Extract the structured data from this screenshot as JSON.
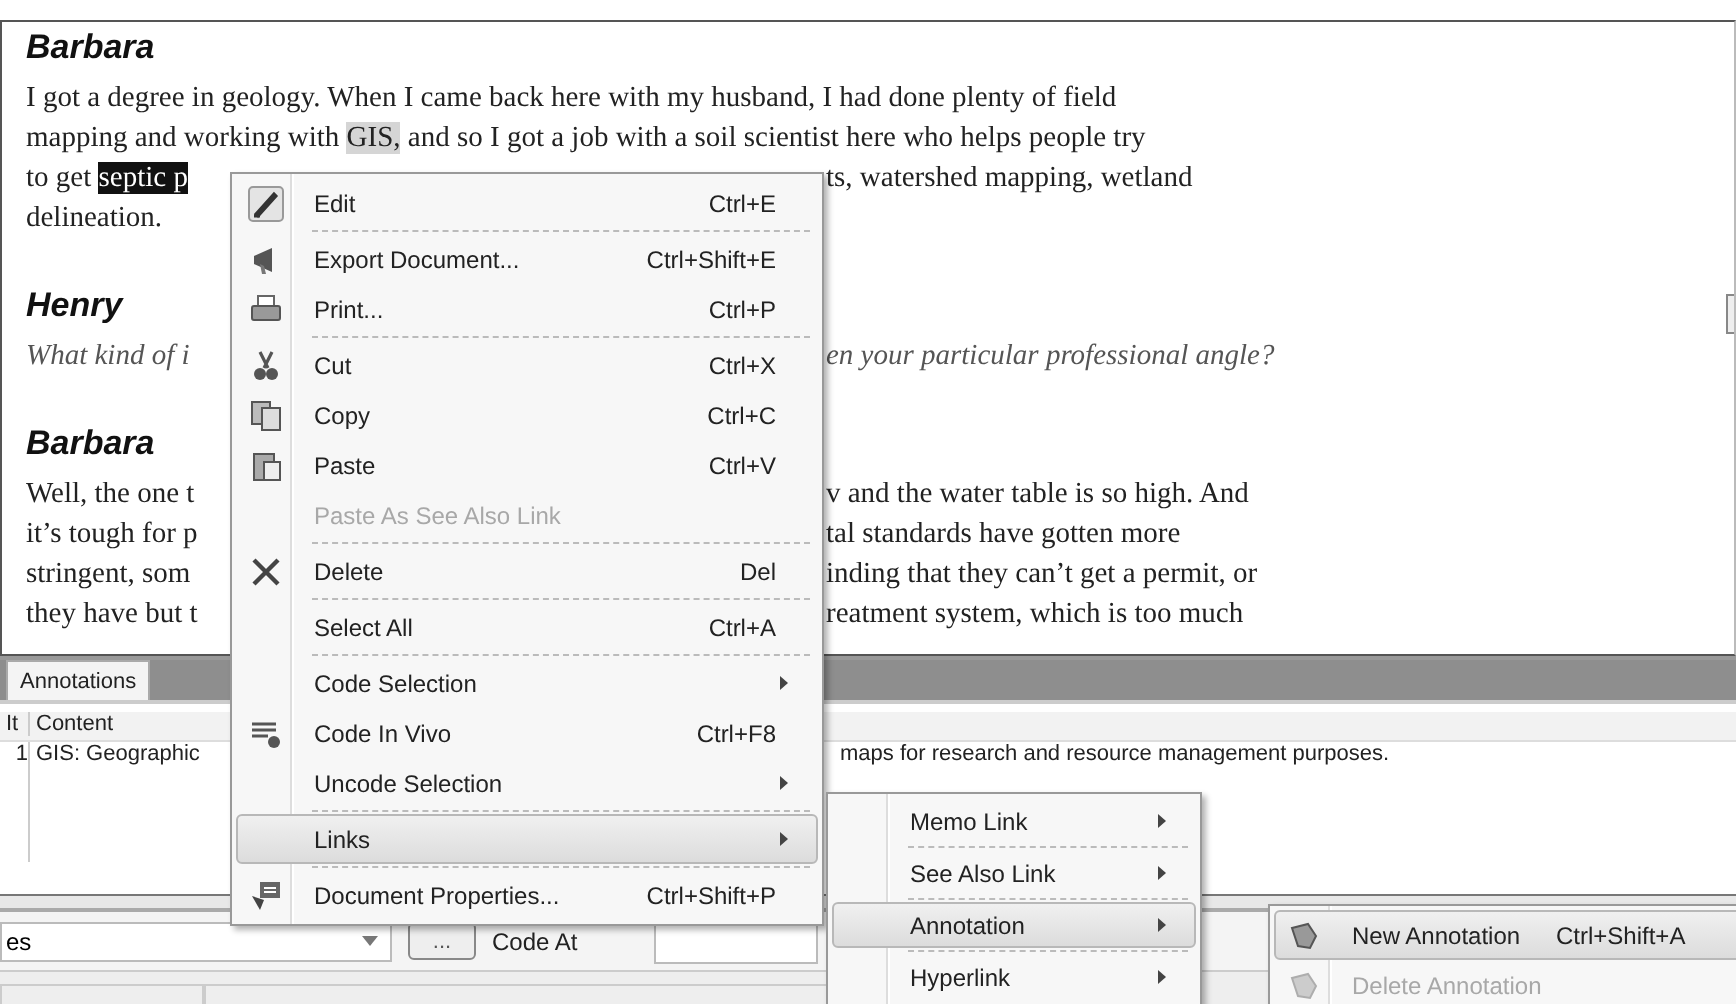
{
  "document": {
    "blocks": [
      {
        "kind": "speaker",
        "text": "Barbara"
      },
      {
        "kind": "line",
        "left": "I got a degree in geology. When I came back here with my husband, I had done plenty of field"
      },
      {
        "kind": "line",
        "left": "mapping and working with **GIS,** and so I got a job with a soil scientist here who helps people try"
      },
      {
        "kind": "line",
        "left": "to get ",
        "selection": "septic p",
        "right": "ts, watershed mapping, wetland"
      },
      {
        "kind": "line",
        "left": "delineation."
      },
      {
        "kind": "speaker",
        "text": "Henry"
      },
      {
        "kind": "question",
        "left": "What kind of i",
        "right": "en your particular professional angle?"
      },
      {
        "kind": "speaker",
        "text": "Barbara"
      },
      {
        "kind": "line",
        "left": "Well, the one t",
        "right": "v and the water table is so high. And"
      },
      {
        "kind": "line",
        "left": "it’s tough for p",
        "right": "tal standards have gotten more"
      },
      {
        "kind": "line",
        "left": "stringent, som",
        "right": "inding that they can’t get a permit, or"
      },
      {
        "kind": "line",
        "left": "they have but t",
        "right": "reatment system, which is too much"
      }
    ]
  },
  "annotations_panel": {
    "tabs": [
      {
        "label": "Annotations",
        "selected": true
      }
    ],
    "columns": [
      "It",
      "Content"
    ],
    "rows": [
      {
        "item": "1",
        "content_left": "GIS: Geographic",
        "content_right": "maps for research and resource management purposes."
      }
    ]
  },
  "toolbar": {
    "combo_value": "es",
    "browse_button": "...",
    "code_at_label": "Code At"
  },
  "context_menu": [
    {
      "kind": "item",
      "label": "Edit",
      "shortcut": "Ctrl+E",
      "disabled": false,
      "highlighted": false,
      "submenu": false
    },
    {
      "kind": "separator"
    },
    {
      "kind": "item",
      "label": "Export Document...",
      "shortcut": "Ctrl+Shift+E",
      "disabled": false,
      "highlighted": false,
      "submenu": false
    },
    {
      "kind": "item",
      "label": "Print...",
      "shortcut": "Ctrl+P",
      "disabled": false,
      "highlighted": false,
      "submenu": false
    },
    {
      "kind": "separator"
    },
    {
      "kind": "item",
      "label": "Cut",
      "shortcut": "Ctrl+X",
      "disabled": false,
      "highlighted": false,
      "submenu": false
    },
    {
      "kind": "item",
      "label": "Copy",
      "shortcut": "Ctrl+C",
      "disabled": false,
      "highlighted": false,
      "submenu": false
    },
    {
      "kind": "item",
      "label": "Paste",
      "shortcut": "Ctrl+V",
      "disabled": false,
      "highlighted": false,
      "submenu": false
    },
    {
      "kind": "item",
      "label": "Paste As See Also Link",
      "disabled": true,
      "highlighted": false,
      "submenu": false
    },
    {
      "kind": "separator"
    },
    {
      "kind": "item",
      "label": "Delete",
      "shortcut": "Del",
      "disabled": false,
      "highlighted": false,
      "submenu": false
    },
    {
      "kind": "separator"
    },
    {
      "kind": "item",
      "label": "Select All",
      "shortcut": "Ctrl+A",
      "disabled": false,
      "highlighted": false,
      "submenu": false
    },
    {
      "kind": "separator"
    },
    {
      "kind": "item",
      "label": "Code Selection",
      "disabled": false,
      "highlighted": false,
      "submenu": true
    },
    {
      "kind": "item",
      "label": "Code In Vivo",
      "shortcut": "Ctrl+F8",
      "disabled": false,
      "highlighted": false,
      "submenu": false
    },
    {
      "kind": "item",
      "label": "Uncode Selection",
      "disabled": false,
      "highlighted": false,
      "submenu": true
    },
    {
      "kind": "separator"
    },
    {
      "kind": "item",
      "label": "Links",
      "disabled": false,
      "highlighted": true,
      "submenu": true
    },
    {
      "kind": "separator"
    },
    {
      "kind": "item",
      "label": "Document Properties...",
      "shortcut": "Ctrl+Shift+P",
      "disabled": false,
      "highlighted": false,
      "submenu": false
    }
  ],
  "links_submenu": [
    {
      "kind": "item",
      "label": "Memo Link",
      "disabled": false,
      "highlighted": false,
      "submenu": true
    },
    {
      "kind": "separator"
    },
    {
      "kind": "item",
      "label": "See Also Link",
      "disabled": false,
      "highlighted": false,
      "submenu": true
    },
    {
      "kind": "separator"
    },
    {
      "kind": "item",
      "label": "Annotation",
      "disabled": false,
      "highlighted": true,
      "submenu": true
    },
    {
      "kind": "separator"
    },
    {
      "kind": "item",
      "label": "Hyperlink",
      "disabled": false,
      "highlighted": false,
      "submenu": true
    }
  ],
  "annotation_submenu": [
    {
      "kind": "item",
      "label": "New Annotation",
      "shortcut": "Ctrl+Shift+A",
      "disabled": false,
      "highlighted": true,
      "submenu": false
    },
    {
      "kind": "item",
      "label": "Delete Annotation",
      "disabled": true,
      "highlighted": false,
      "submenu": false
    }
  ]
}
